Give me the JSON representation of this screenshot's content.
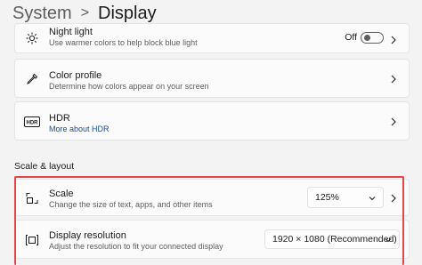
{
  "breadcrumb": {
    "parent": "System",
    "separator": ">",
    "current": "Display"
  },
  "night_light": {
    "title": "Night light",
    "subtitle": "Use warmer colors to help block blue light",
    "toggle_state": "Off",
    "icon": "brightness-icon"
  },
  "color_profile": {
    "title": "Color profile",
    "subtitle": "Determine how colors appear on your screen",
    "icon": "eyedropper-icon"
  },
  "hdr": {
    "title": "HDR",
    "link": "More about HDR",
    "icon": "hdr-icon",
    "icon_text": "HDR"
  },
  "section": {
    "title": "Scale & layout"
  },
  "scale": {
    "title": "Scale",
    "subtitle": "Change the size of text, apps, and other items",
    "value": "125%",
    "icon": "scale-icon"
  },
  "resolution": {
    "title": "Display resolution",
    "subtitle": "Adjust the resolution to fit your connected display",
    "value": "1920 × 1080 (Recommended)",
    "icon": "resolution-icon"
  },
  "colors": {
    "highlight": "#e34848",
    "link": "#1b4f8f",
    "background": "#f3f3f3",
    "card": "#fbfbfb"
  }
}
